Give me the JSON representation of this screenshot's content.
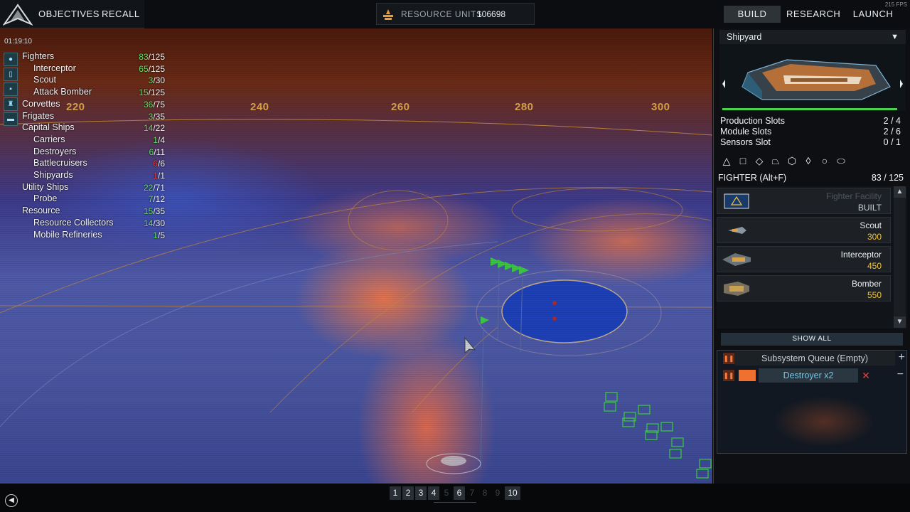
{
  "hud": {
    "fps": "215 FPS",
    "timer": "01:19:10",
    "nav": {
      "objectives": "OBJECTIVES",
      "recall": "RECALL"
    },
    "resource": {
      "label": "RESOURCE UNITS",
      "value": "106698"
    },
    "tabs": {
      "build": "BUILD",
      "research": "RESEARCH",
      "launch": "LAUNCH",
      "active": "BUILD"
    }
  },
  "map": {
    "axis_labels": [
      "220",
      "240",
      "260",
      "280",
      "300"
    ]
  },
  "fleet": {
    "rows": [
      {
        "name": "Fighters",
        "current": "83",
        "max": "/125",
        "indent": 0,
        "state": "ok"
      },
      {
        "name": "Interceptor",
        "current": "65",
        "max": "/125",
        "indent": 1,
        "state": "ok"
      },
      {
        "name": "Scout",
        "current": "3",
        "max": "/30",
        "indent": 1,
        "state": "ok"
      },
      {
        "name": "Attack Bomber",
        "current": "15",
        "max": "/125",
        "indent": 1,
        "state": "ok"
      },
      {
        "name": "Corvettes",
        "current": "36",
        "max": "/75",
        "indent": 0,
        "state": "ok"
      },
      {
        "name": "Frigates",
        "current": "3",
        "max": "/35",
        "indent": 0,
        "state": "ok"
      },
      {
        "name": "Capital Ships",
        "current": "14",
        "max": "/22",
        "indent": 0,
        "state": "ok"
      },
      {
        "name": "Carriers",
        "current": "1",
        "max": "/4",
        "indent": 1,
        "state": "ok"
      },
      {
        "name": "Destroyers",
        "current": "6",
        "max": "/11",
        "indent": 1,
        "state": "ok"
      },
      {
        "name": "Battlecruisers",
        "current": "6",
        "max": "/6",
        "indent": 1,
        "state": "full"
      },
      {
        "name": "Shipyards",
        "current": "1",
        "max": "/1",
        "indent": 1,
        "state": "full"
      },
      {
        "name": "Utility Ships",
        "current": "22",
        "max": "/71",
        "indent": 0,
        "state": "ok"
      },
      {
        "name": "Probe",
        "current": "7",
        "max": "/12",
        "indent": 1,
        "state": "ok"
      },
      {
        "name": "Resource",
        "current": "15",
        "max": "/35",
        "indent": 0,
        "state": "ok"
      },
      {
        "name": "Resource Collectors",
        "current": "14",
        "max": "/30",
        "indent": 1,
        "state": "ok"
      },
      {
        "name": "Mobile Refineries",
        "current": "1",
        "max": "/5",
        "indent": 1,
        "state": "ok"
      }
    ]
  },
  "panel": {
    "selected_ship": "Shipyard",
    "health_fraction": 1.0,
    "stats": [
      {
        "label": "Production Slots",
        "value": "2 / 4"
      },
      {
        "label": "Module Slots",
        "value": "2 / 6"
      },
      {
        "label": "Sensors Slot",
        "value": "0 / 1"
      }
    ],
    "filter_shapes": [
      "triangle",
      "square",
      "diamond",
      "trapezoid",
      "hexagon",
      "kite",
      "circle",
      "capsule"
    ],
    "category": {
      "label": "FIGHTER (Alt+F)",
      "value": "83 / 125"
    },
    "build_items": [
      {
        "name": "Fighter Facility",
        "cost": "BUILT",
        "icon": "fighter-facility-icon",
        "state": "built"
      },
      {
        "name": "Scout",
        "cost": "300",
        "icon": "scout-ship-icon",
        "state": "available"
      },
      {
        "name": "Interceptor",
        "cost": "450",
        "icon": "interceptor-ship-icon",
        "state": "available"
      },
      {
        "name": "Bomber",
        "cost": "550",
        "icon": "bomber-ship-icon",
        "state": "available"
      }
    ],
    "show_all": "SHOW ALL",
    "queue": {
      "subsystem_label": "Subsystem Queue (Empty)",
      "items": [
        {
          "label": "Destroyer x2",
          "color": "#f07030"
        }
      ]
    }
  },
  "control_groups": [
    {
      "label": "1",
      "active": true
    },
    {
      "label": "2",
      "active": true
    },
    {
      "label": "3",
      "active": true
    },
    {
      "label": "4",
      "active": true
    },
    {
      "label": "5",
      "active": false
    },
    {
      "label": "6",
      "active": true
    },
    {
      "label": "7",
      "active": false
    },
    {
      "label": "8",
      "active": false
    },
    {
      "label": "9",
      "active": false
    },
    {
      "label": "10",
      "active": true
    }
  ],
  "colors": {
    "accent_green": "#5fe05f",
    "warning_red": "#e04040",
    "cost_gold": "#f0c23a",
    "map_grid": "#d9a24a"
  }
}
